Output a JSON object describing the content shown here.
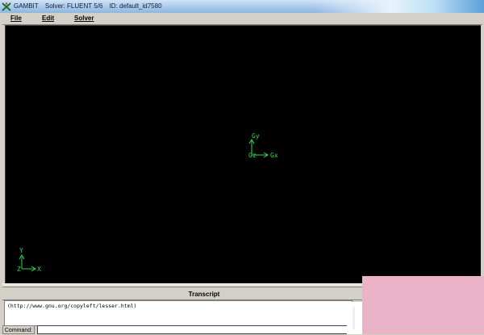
{
  "window": {
    "app_name": "GAMBIT",
    "solver": "Solver: FLUENT 5/6",
    "id": "ID: default_id7580"
  },
  "menu": {
    "file": "File",
    "edit": "Edit",
    "solver": "Solver"
  },
  "graphics": {
    "triad_center": {
      "y": "Gy",
      "x": "Gx",
      "z": "Gz"
    },
    "triad_corner": {
      "y": "Y",
      "x": "X",
      "z": "Z"
    },
    "triad_color": "#32d650"
  },
  "transcript": {
    "title": "Transcript",
    "lines": [
      "(http://www.gnu.org/copyleft/lesser.html)"
    ]
  },
  "command": {
    "label": "Command:",
    "value": ""
  }
}
